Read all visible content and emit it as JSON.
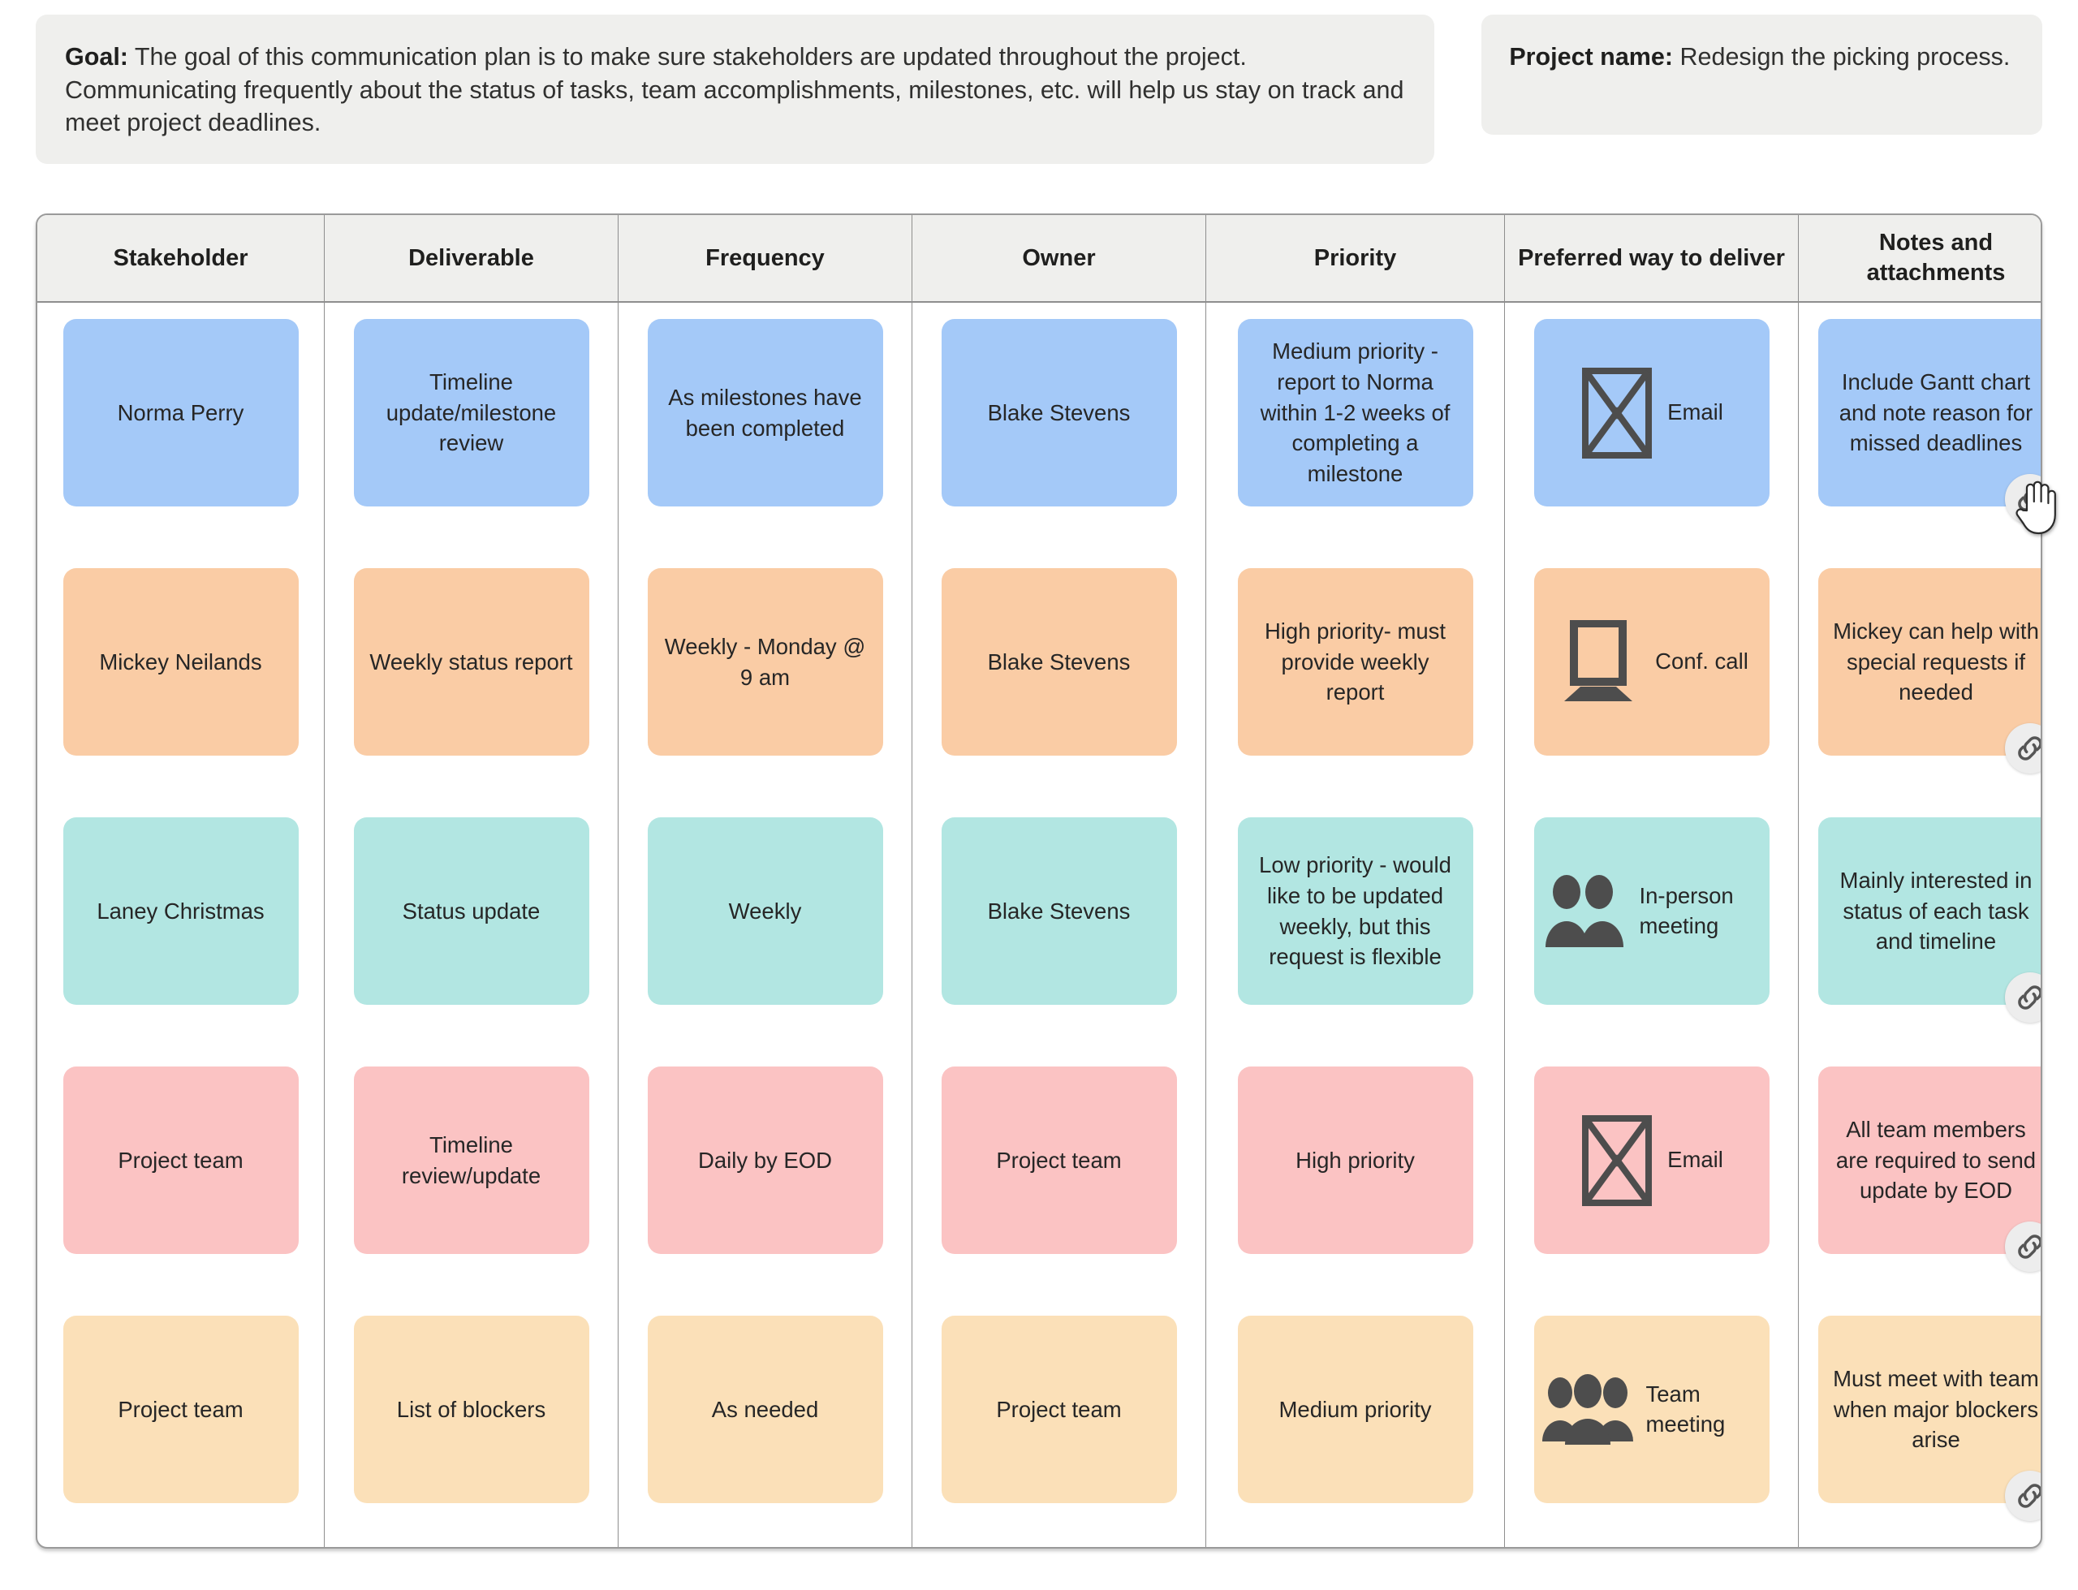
{
  "header": {
    "goal": {
      "label": "Goal:",
      "text": "The goal of this communication plan is to make sure stakeholders are updated throughout the project. Communicating frequently about the status of tasks, team accomplishments, milestones, etc. will help us stay on track and meet project deadlines."
    },
    "project": {
      "label": "Project name:",
      "text": "Redesign the picking process."
    }
  },
  "table": {
    "columns": [
      "Stakeholder",
      "Deliverable",
      "Frequency",
      "Owner",
      "Priority",
      "Preferred way to deliver",
      "Notes and attachments"
    ],
    "rows": [
      {
        "color": "#a4c9f8",
        "stakeholder": "Norma Perry",
        "deliverable": "Timeline update/milestone review",
        "frequency": "As milestones have been completed",
        "owner": "Blake Stevens",
        "priority": "Medium priority - report to Norma within 1-2 weeks of completing a milestone",
        "delivery_icon": "envelope-icon",
        "delivery": "Email",
        "notes": "Include Gantt chart and note reason for missed deadlines",
        "attachment_icon": "link-icon"
      },
      {
        "color": "#facca5",
        "stakeholder": "Mickey Neilands",
        "deliverable": "Weekly status report",
        "frequency": "Weekly - Monday @ 9 am",
        "owner": "Blake Stevens",
        "priority": "High priority- must provide weekly report",
        "delivery_icon": "laptop-icon",
        "delivery": "Conf. call",
        "notes": "Mickey can help with special requests if needed",
        "attachment_icon": "link-icon"
      },
      {
        "color": "#b2e6e2",
        "stakeholder": "Laney Christmas",
        "deliverable": "Status update",
        "frequency": "Weekly",
        "owner": "Blake Stevens",
        "priority": "Low priority - would like to be updated weekly, but this request is flexible",
        "delivery_icon": "two-people-icon",
        "delivery": "In-person meeting",
        "notes": "Mainly interested in status of each task and timeline",
        "attachment_icon": "link-icon"
      },
      {
        "color": "#fbc3c3",
        "stakeholder": "Project team",
        "deliverable": "Timeline review/update",
        "frequency": "Daily by EOD",
        "owner": "Project team",
        "priority": "High priority",
        "delivery_icon": "envelope-icon",
        "delivery": "Email",
        "notes": "All team members are required to send update by EOD",
        "attachment_icon": "link-icon"
      },
      {
        "color": "#fbe0b8",
        "stakeholder": "Project team",
        "deliverable": "List of blockers",
        "frequency": "As needed",
        "owner": "Project team",
        "priority": "Medium priority",
        "delivery_icon": "three-people-icon",
        "delivery": "Team meeting",
        "notes": "Must meet with team when major blockers arise",
        "attachment_icon": "link-icon"
      }
    ]
  },
  "pointer": {
    "icon": "hand-pointer-cursor"
  },
  "colors": {
    "banner_bg": "#efefed",
    "header_bg": "#efefed",
    "border": "#8e8e8e",
    "icon": "#4d4d4d",
    "badge_bg": "#ededed"
  }
}
